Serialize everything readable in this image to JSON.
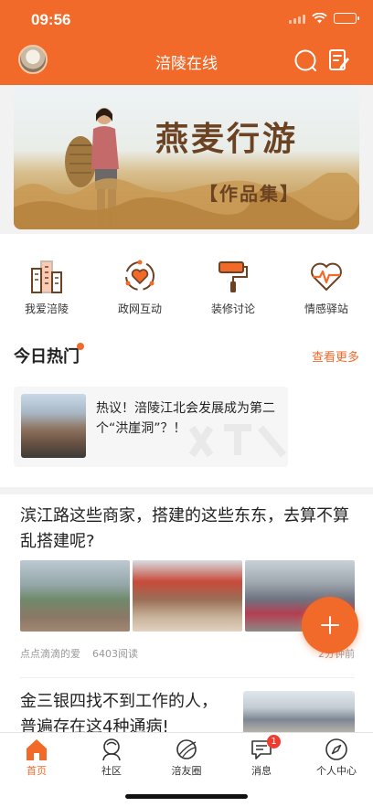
{
  "status_bar": {
    "time": "09:56"
  },
  "nav": {
    "title": "涪陵在线",
    "icons": [
      "avatar",
      "search-icon",
      "edit-note-icon"
    ]
  },
  "banner": {
    "title": "燕麦行游",
    "subtitle": "【作品集】"
  },
  "quick_links": [
    {
      "label": "我爱涪陵",
      "icon": "buildings-icon"
    },
    {
      "label": "政网互动",
      "icon": "heart-cycle-icon"
    },
    {
      "label": "装修讨论",
      "icon": "paint-roller-icon"
    },
    {
      "label": "情感驿站",
      "icon": "heartbeat-icon"
    }
  ],
  "hot_section": {
    "title": "今日热门",
    "see_more": "查看更多",
    "items": [
      {
        "text": "热议！涪陵江北会发展成为第二个“洪崖洞”？！"
      }
    ]
  },
  "feed": [
    {
      "title": "滨江路这些商家，搭建的这些东东，去算不算乱搭建呢?",
      "author": "点点滴滴的爱",
      "reads": "6403阅读",
      "time": "2分钟前"
    },
    {
      "title": "金三银四找不到工作的人，普遍存在这4种通病!"
    }
  ],
  "tabbar": {
    "tabs": [
      {
        "label": "首页",
        "icon": "home-icon",
        "active": true
      },
      {
        "label": "社区",
        "icon": "community-icon"
      },
      {
        "label": "涪友圈",
        "icon": "planet-icon"
      },
      {
        "label": "消息",
        "icon": "message-icon",
        "badge": "1"
      },
      {
        "label": "个人中心",
        "icon": "compass-icon"
      }
    ]
  },
  "colors": {
    "accent": "#f26a2a",
    "badge": "#f03b30",
    "brown": "#6b4222"
  }
}
